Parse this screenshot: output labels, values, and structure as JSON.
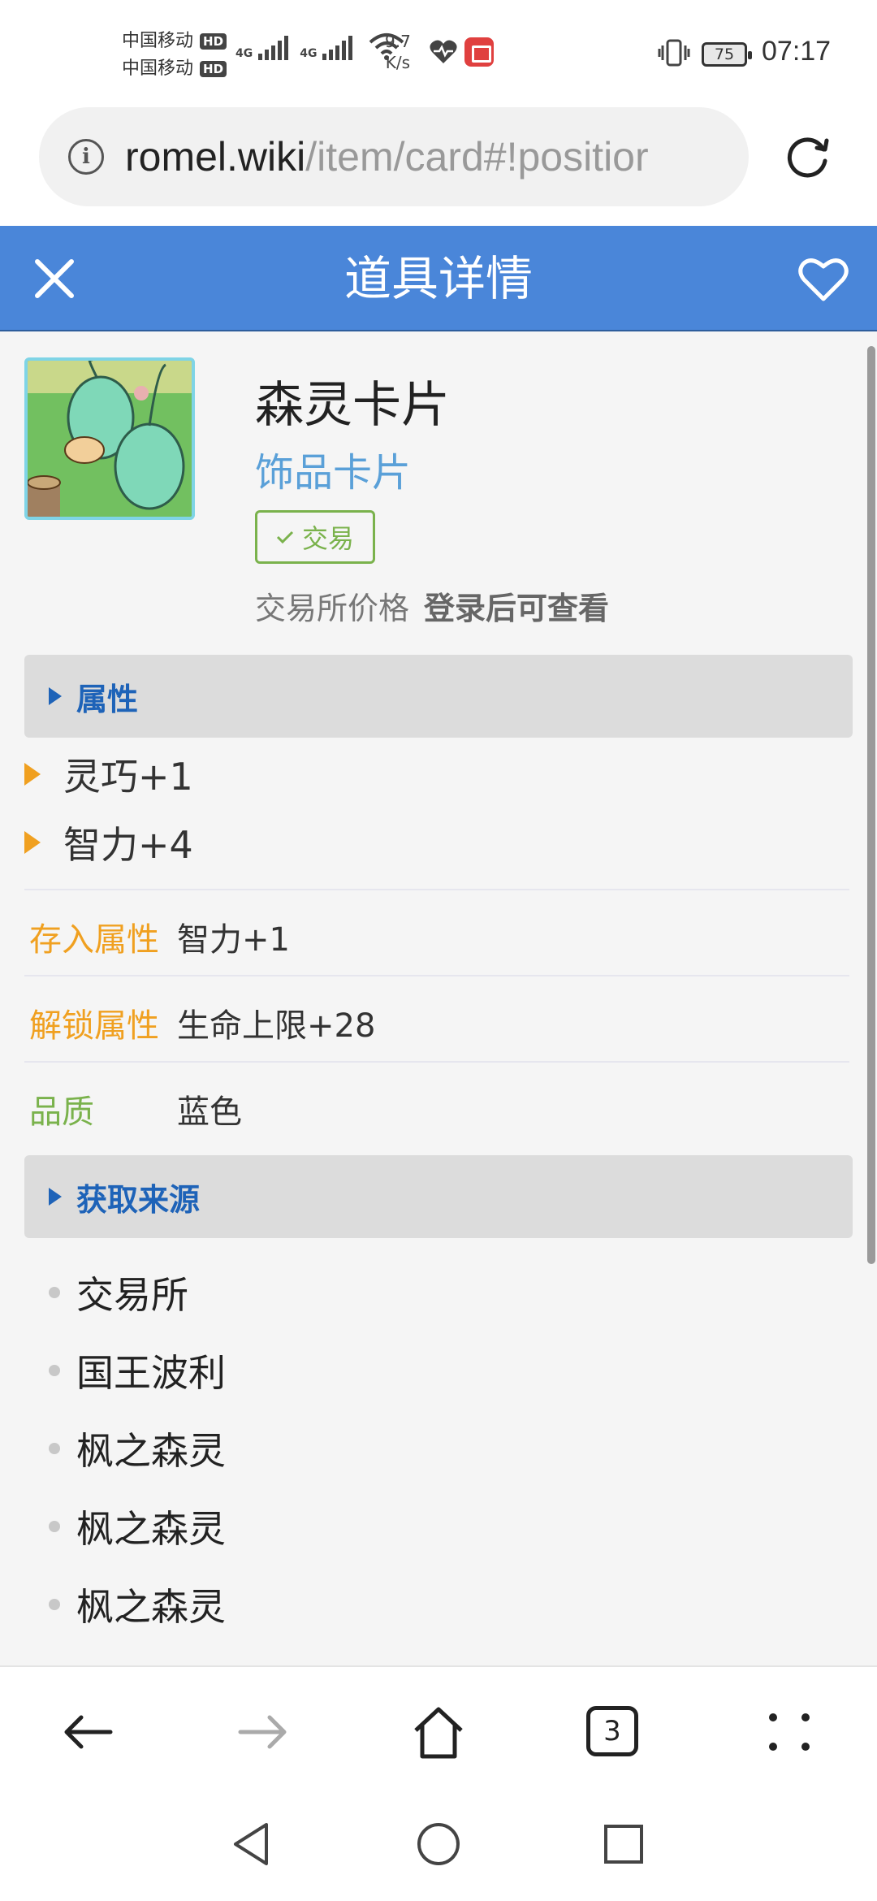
{
  "status_bar": {
    "carrier1": "中国移动",
    "carrier2": "中国移动",
    "hd1": "HD",
    "hd2": "HD",
    "net1": "4G",
    "net2": "4G",
    "speed_value": "9.7",
    "speed_unit": "K/s",
    "battery": "75",
    "time": "07:17",
    "icons": [
      "wifi-icon",
      "heart-pulse-icon",
      "book-app-icon",
      "vibrate-icon",
      "battery-icon"
    ]
  },
  "url_bar": {
    "domain": "romel.wiki",
    "path": "/item/card#!positior"
  },
  "header": {
    "title": "道具详情",
    "accent_color": "#4a86d9"
  },
  "item": {
    "name": "森灵卡片",
    "type": "饰品卡片",
    "trade_badge": "交易",
    "price_label": "交易所价格",
    "price_value": "登录后可查看"
  },
  "attributes_section": {
    "title": "属性",
    "items": [
      "灵巧+1",
      "智力+4"
    ]
  },
  "details": {
    "deposit_label": "存入属性",
    "deposit_value": "智力+1",
    "unlock_label": "解锁属性",
    "unlock_value": "生命上限+28",
    "quality_label": "品质",
    "quality_value": "蓝色"
  },
  "sources_section": {
    "title": "获取来源",
    "items": [
      "交易所",
      "国王波利",
      "枫之森灵",
      "枫之森灵",
      "枫之森灵"
    ]
  },
  "bottom_nav": {
    "tabs_count": "3"
  }
}
